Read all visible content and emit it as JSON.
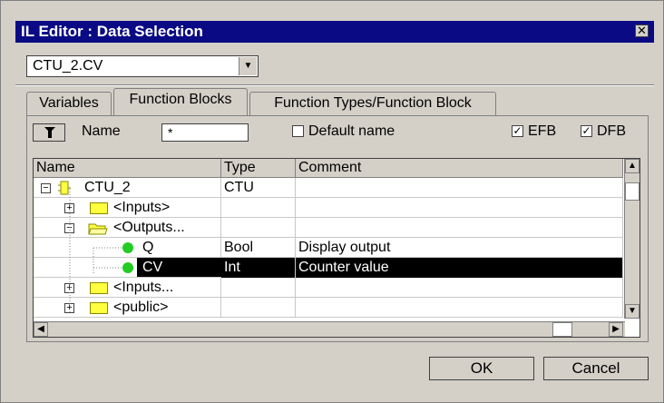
{
  "window": {
    "title": "IL Editor : Data Selection",
    "close_glyph": "✕"
  },
  "selector": {
    "value": "CTU_2.CV"
  },
  "tabs": [
    {
      "label": "Variables",
      "active": false
    },
    {
      "label": "Function Blocks",
      "active": true
    },
    {
      "label": "Function Types/Function Block",
      "active": false
    }
  ],
  "filter": {
    "name_label": "Name",
    "name_value": "*",
    "default_name_label": "Default name",
    "default_name_checked": false,
    "efb_label": "EFB",
    "efb_checked": true,
    "dfb_label": "DFB",
    "dfb_checked": true
  },
  "table": {
    "columns": [
      "Name",
      "Type",
      "Comment"
    ],
    "rows": [
      {
        "name": "CTU_2",
        "type": "CTU",
        "comment": "",
        "icon": "function-block-icon",
        "expander": "−"
      },
      {
        "name": "<Inputs>",
        "type": "",
        "comment": "",
        "icon": "folder-icon",
        "expander": "+"
      },
      {
        "name": "<Outputs...",
        "type": "",
        "comment": "",
        "icon": "open-folder-icon",
        "expander": "−"
      },
      {
        "name": "Q",
        "type": "Bool",
        "comment": "Display output",
        "icon": "green-dot-icon"
      },
      {
        "name": "CV",
        "type": "Int",
        "comment": "Counter value",
        "icon": "green-dot-icon",
        "selected": true
      },
      {
        "name": "<Inputs...",
        "type": "",
        "comment": "",
        "icon": "folder-icon",
        "expander": "+"
      },
      {
        "name": "<public>",
        "type": "",
        "comment": "",
        "icon": "folder-icon",
        "expander": "+"
      }
    ]
  },
  "buttons": {
    "ok": "OK",
    "cancel": "Cancel"
  },
  "colors": {
    "titlebar": "#0a0a84",
    "selection": "#000000",
    "folder": "#ffff40",
    "status_dot": "#22cc22"
  }
}
